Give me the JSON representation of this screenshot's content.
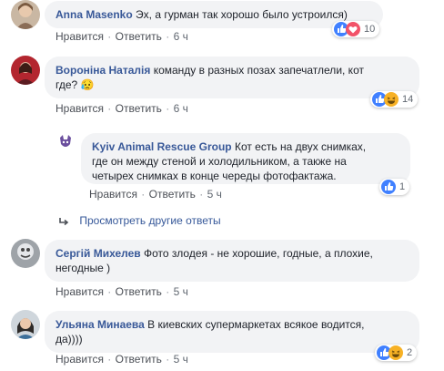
{
  "comments": [
    {
      "author": "Anna Masenko",
      "text": "Эх, а гурман так хорошо было устроился)",
      "like_label": "Нравится",
      "reply_label": "Ответить",
      "time": "6 ч",
      "reactions_count": "10",
      "reactions": [
        "like-icon",
        "love-icon"
      ]
    },
    {
      "author": "Вороніна Наталія",
      "text_line1": "команду в разных позах запечатлели, кот",
      "text_line2": "где? 😥",
      "like_label": "Нравится",
      "reply_label": "Ответить",
      "time": "6 ч",
      "reactions_count": "14",
      "reactions": [
        "like-icon",
        "haha-icon"
      ]
    },
    {
      "author": "Kyiv Animal Rescue Group",
      "text_line1": "Кот есть на двух снимках,",
      "text_line2": "где он между стеной и холодильником, а также на",
      "text_line3": "четырех снимках в конце череды фотофактажа.",
      "like_label": "Нравится",
      "reply_label": "Ответить",
      "time": "5 ч",
      "reactions_count": "1",
      "reactions": [
        "like-icon"
      ]
    },
    {
      "author": "Сергій Михелев",
      "text_line1": "Фото злодея - не хорошие, годные, а плохие,",
      "text_line2": "негодные )",
      "like_label": "Нравится",
      "reply_label": "Ответить",
      "time": "5 ч"
    },
    {
      "author": "Ульяна Минаева",
      "text_line1": "В киевских супермаркетах всякое водится,",
      "text_line2": "да))))",
      "like_label": "Нравится",
      "reply_label": "Ответить",
      "time": "5 ч",
      "reactions_count": "2",
      "reactions": [
        "like-icon",
        "haha-icon"
      ]
    }
  ],
  "more_replies": "Просмотреть другие ответы",
  "colors": {
    "author": "#385898",
    "bubble": "#f2f3f5",
    "like": "#4080ff",
    "love": "#f25268",
    "haha": "#f7b125"
  }
}
